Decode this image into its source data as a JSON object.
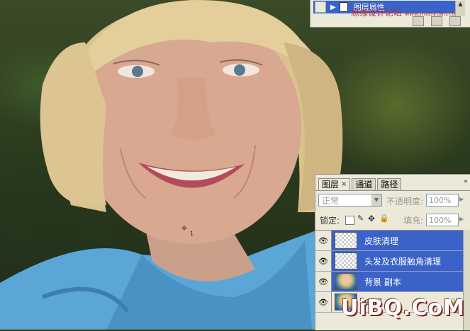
{
  "style_panel": {
    "row_label": "图层属性",
    "watermark": "思缘设计论坛",
    "watermark_url": "www.missyuan.com"
  },
  "layers_panel": {
    "tabs": [
      {
        "label": "图层",
        "close": "×"
      },
      {
        "label": "通道"
      },
      {
        "label": "路径"
      }
    ],
    "menu_icon": "»",
    "blend_mode": "正常",
    "opacity_label": "不透明度:",
    "opacity_value": "100%",
    "lock_label": "锁定:",
    "fill_label": "填充:",
    "fill_value": "100%",
    "layers": [
      {
        "name": "皮肤清理",
        "selected": true,
        "thumb": "transparent"
      },
      {
        "name": "头发及衣服触角清理",
        "selected": true,
        "thumb": "transparent"
      },
      {
        "name": "背景 副本",
        "selected": true,
        "thumb": "photo"
      },
      {
        "name": "背景",
        "selected": false,
        "thumb": "photo",
        "locked": true
      }
    ]
  },
  "site_watermark": "UiBQ.CoM",
  "cursor_label": "1",
  "colors": {
    "panel_bg": "#ece9d8",
    "selection": "#3a62c8",
    "shirt": "#5fa8d8"
  }
}
